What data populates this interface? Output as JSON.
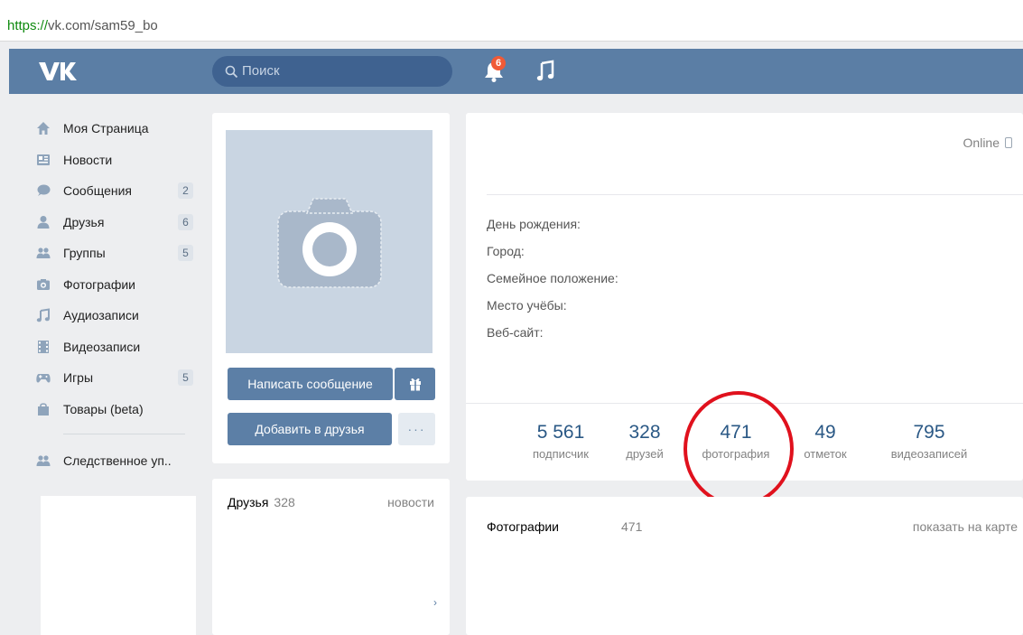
{
  "browser": {
    "url_protocol": "https://",
    "url_rest": "vk.com/sam59_bo"
  },
  "header": {
    "logo": "vk-logo",
    "search_placeholder": "Поиск",
    "notifications_count": "6",
    "colors": {
      "header": "#5b7ea5",
      "search": "#3f6290",
      "badge": "#f05a36"
    }
  },
  "sidebar": {
    "items": [
      {
        "label": "Моя Страница",
        "icon": "home-icon",
        "count": ""
      },
      {
        "label": "Новости",
        "icon": "news-icon",
        "count": ""
      },
      {
        "label": "Сообщения",
        "icon": "messages-icon",
        "count": "2"
      },
      {
        "label": "Друзья",
        "icon": "user-icon",
        "count": "6"
      },
      {
        "label": "Группы",
        "icon": "groups-icon",
        "count": "5"
      },
      {
        "label": "Фотографии",
        "icon": "camera-icon",
        "count": ""
      },
      {
        "label": "Аудиозаписи",
        "icon": "music-note-icon",
        "count": ""
      },
      {
        "label": "Видеозаписи",
        "icon": "film-icon",
        "count": ""
      },
      {
        "label": "Игры",
        "icon": "gamepad-icon",
        "count": "5"
      },
      {
        "label": "Товары (beta)",
        "icon": "shopping-bag-icon",
        "count": ""
      }
    ],
    "extra": {
      "label": "Следственное уп..",
      "icon": "groups-icon"
    }
  },
  "profile": {
    "write_message": "Написать сообщение",
    "add_friend": "Добавить в друзья",
    "more": "···",
    "online": "Online",
    "info_labels": [
      "День рождения:",
      "Город:",
      "Семейное положение:",
      "Место учёбы:",
      "Веб-сайт:"
    ]
  },
  "stats": [
    {
      "value": "5 561",
      "label": "подписчик"
    },
    {
      "value": "328",
      "label": "друзей"
    },
    {
      "value": "471",
      "label": "фотография"
    },
    {
      "value": "49",
      "label": "отметок"
    },
    {
      "value": "795",
      "label": "видеозаписей"
    }
  ],
  "friends": {
    "title": "Друзья",
    "count": "328",
    "news": "новости",
    "arrow": "›"
  },
  "photos": {
    "title": "Фотографии",
    "count": "471",
    "map_link": "показать на карте"
  },
  "annotation": {
    "color": "#e0111d",
    "target": "photos-stat"
  }
}
